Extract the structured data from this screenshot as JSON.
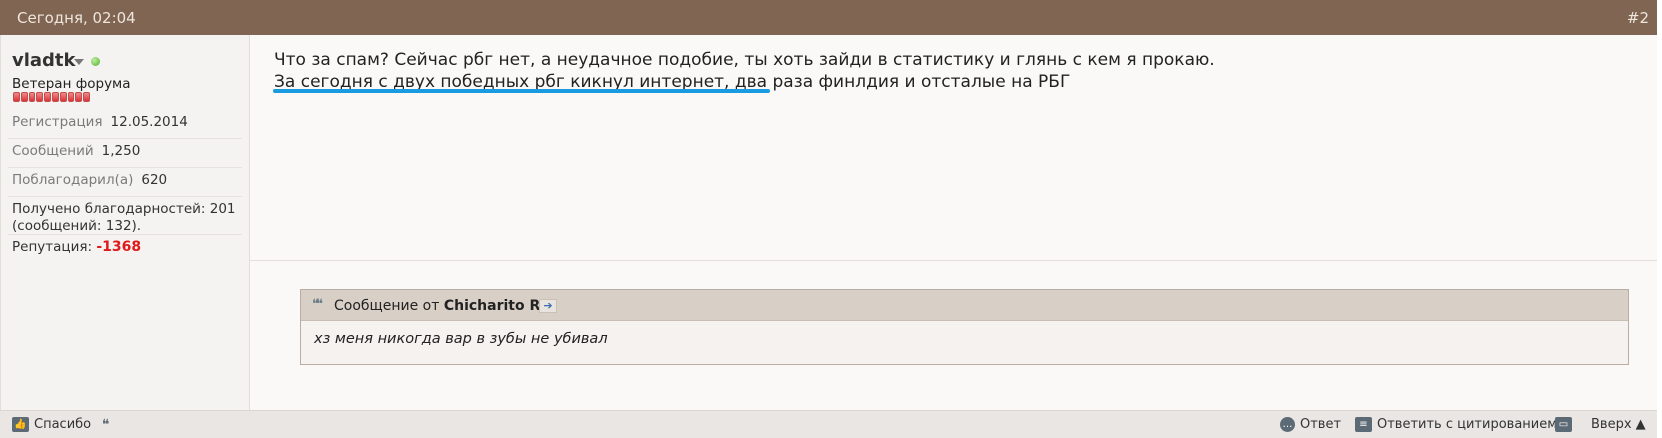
{
  "header": {
    "date": "Сегодня, 02:04",
    "post_number": "#2"
  },
  "user": {
    "name": "vladtk",
    "title": "Ветеран форума",
    "registration_label": "Регистрация",
    "registration_value": "12.05.2014",
    "messages_label": "Сообщений",
    "messages_value": "1,250",
    "thanked_label": "Поблагодарил(а)",
    "thanked_value": "620",
    "received_line1": "Получено благодарностей: 201",
    "received_line2": "(сообщений: 132).",
    "reputation_label": "Репутация:",
    "reputation_value": "-1368"
  },
  "message": {
    "line1": "Что за спам? Сейчас рбг нет, а неудачное подобие, ты хоть зайди в статистику и глянь с кем я прокаю.",
    "line2": "За сегодня с двух победных рбг кикнул интернет, два раза финлдия и отсталые на РБГ"
  },
  "quote": {
    "prefix": "Сообщение от",
    "author": "Chicharito RM",
    "text": "хз меня никогда вар в зубы не убивал"
  },
  "footer": {
    "thanks_label": "Спасибо",
    "reply_label": "Ответ",
    "reply_quote_label": "Ответить с цитированием",
    "top_label": "Вверх ▲"
  },
  "colors": {
    "header_bg": "#7f6552",
    "reputation_negative": "#e01a1a",
    "highlight_underline": "#1a9be0"
  }
}
